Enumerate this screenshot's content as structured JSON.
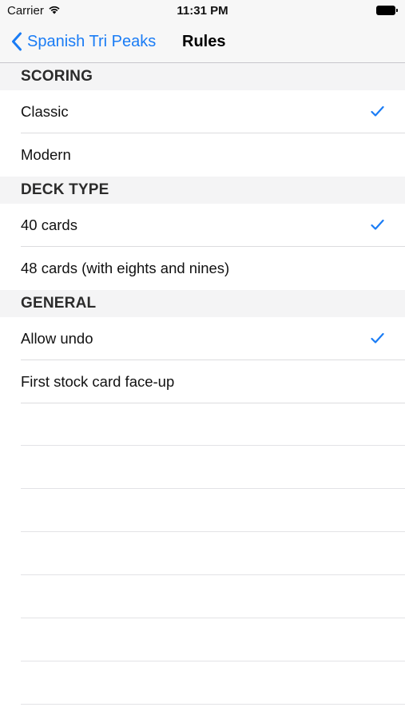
{
  "status_bar": {
    "carrier": "Carrier",
    "time": "11:31 PM"
  },
  "nav_bar": {
    "back_label": "Spanish Tri Peaks",
    "title": "Rules"
  },
  "sections": [
    {
      "header": "SCORING",
      "rows": [
        {
          "label": "Classic",
          "checked": true
        },
        {
          "label": "Modern",
          "checked": false
        }
      ]
    },
    {
      "header": "DECK TYPE",
      "rows": [
        {
          "label": "40 cards",
          "checked": true
        },
        {
          "label": "48 cards (with eights and nines)",
          "checked": false
        }
      ]
    },
    {
      "header": "GENERAL",
      "rows": [
        {
          "label": "Allow undo",
          "checked": true
        },
        {
          "label": "First stock card face-up",
          "checked": false
        }
      ]
    }
  ],
  "colors": {
    "accent": "#1a7cf5",
    "section_background": "#f4f4f5",
    "separator": "#dcdcdf"
  },
  "icons": {
    "back": "chevron-left-icon",
    "selected": "checkmark-icon",
    "signal": "wifi-icon",
    "battery": "battery-icon"
  }
}
